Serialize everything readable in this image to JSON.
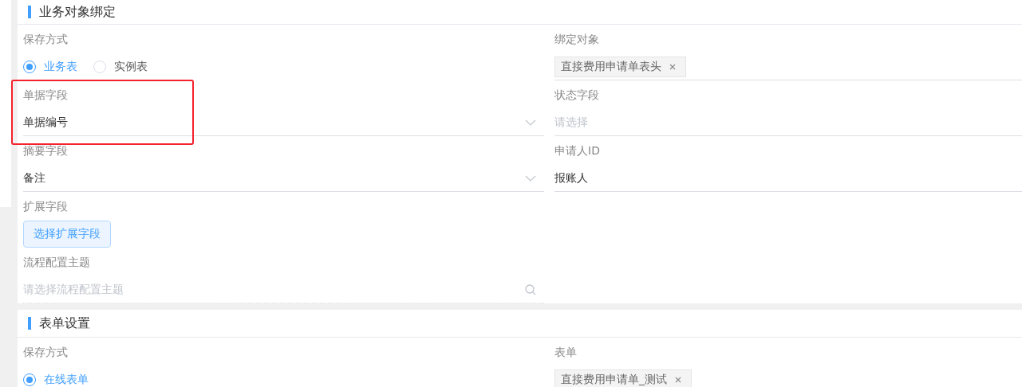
{
  "sections": [
    {
      "title": "业务对象绑定",
      "rows": [
        [
          {
            "kind": "radio",
            "label": "保存方式",
            "options": [
              {
                "label": "业务表",
                "selected": true
              },
              {
                "label": "实例表",
                "selected": false
              }
            ]
          },
          {
            "kind": "tags",
            "label": "绑定对象",
            "tags": [
              "直接费用申请单表头"
            ]
          }
        ],
        [
          {
            "kind": "select",
            "label": "单据字段",
            "value": "单据编号"
          },
          {
            "kind": "input",
            "label": "状态字段",
            "placeholder": "请选择"
          }
        ],
        [
          {
            "kind": "select",
            "label": "摘要字段",
            "value": "备注"
          },
          {
            "kind": "input",
            "label": "申请人ID",
            "value": "报账人"
          }
        ],
        [
          {
            "kind": "button",
            "label": "扩展字段",
            "button": "选择扩展字段"
          }
        ],
        [
          {
            "kind": "search",
            "label": "流程配置主题",
            "placeholder": "请选择流程配置主题"
          }
        ]
      ]
    },
    {
      "title": "表单设置",
      "rows": [
        [
          {
            "kind": "radio",
            "label": "保存方式",
            "options": [
              {
                "label": "在线表单",
                "selected": true
              }
            ]
          },
          {
            "kind": "tags",
            "label": "表单",
            "tags": [
              "直接费用申请单_测试"
            ]
          }
        ]
      ]
    }
  ]
}
